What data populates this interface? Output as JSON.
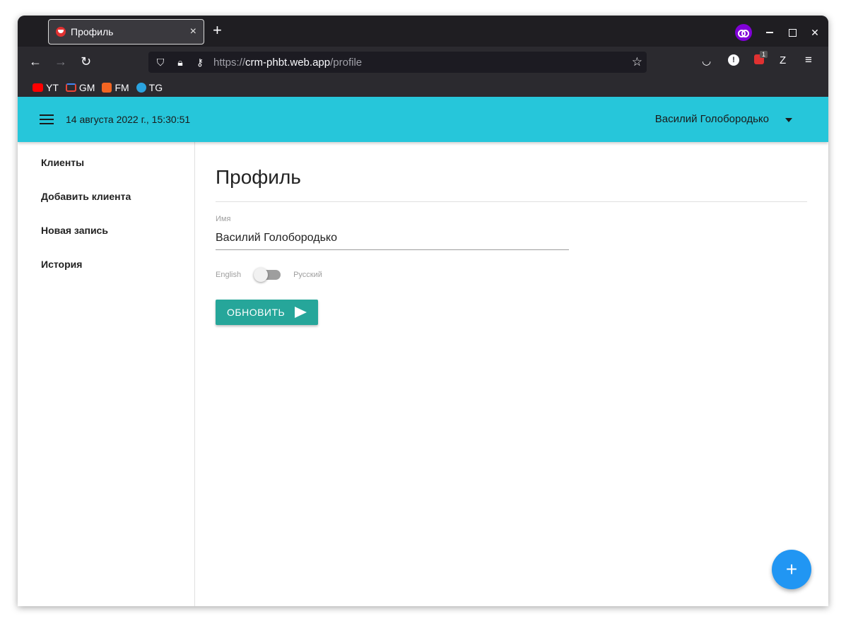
{
  "browser": {
    "tab_title": "Профиль",
    "tab_close": "×",
    "new_tab": "+",
    "url_proto": "https://",
    "url_host": "crm-phbt.web.app",
    "url_path": "/profile",
    "extension_badge": "1",
    "bookmarks": [
      {
        "label": "YT",
        "icon": "youtube-icon"
      },
      {
        "label": "GM",
        "icon": "gmail-icon"
      },
      {
        "label": "FM",
        "icon": "fm-icon"
      },
      {
        "label": "TG",
        "icon": "telegram-icon"
      }
    ]
  },
  "appbar": {
    "datetime": "14 августа 2022 г., 15:30:51",
    "user": "Василий Голобородько",
    "color": "#26c6da"
  },
  "sidebar": {
    "items": [
      {
        "label": "Клиенты"
      },
      {
        "label": "Добавить клиента"
      },
      {
        "label": "Новая запись"
      },
      {
        "label": "История"
      }
    ]
  },
  "main": {
    "title": "Профиль",
    "name_label": "Имя",
    "name_value": "Василий Голобородько",
    "lang_left": "English",
    "lang_right": "Русский",
    "update_button": "ОБНОВИТЬ",
    "button_color": "#26a69a"
  },
  "fab": {
    "label": "+",
    "color": "#2196f3"
  }
}
